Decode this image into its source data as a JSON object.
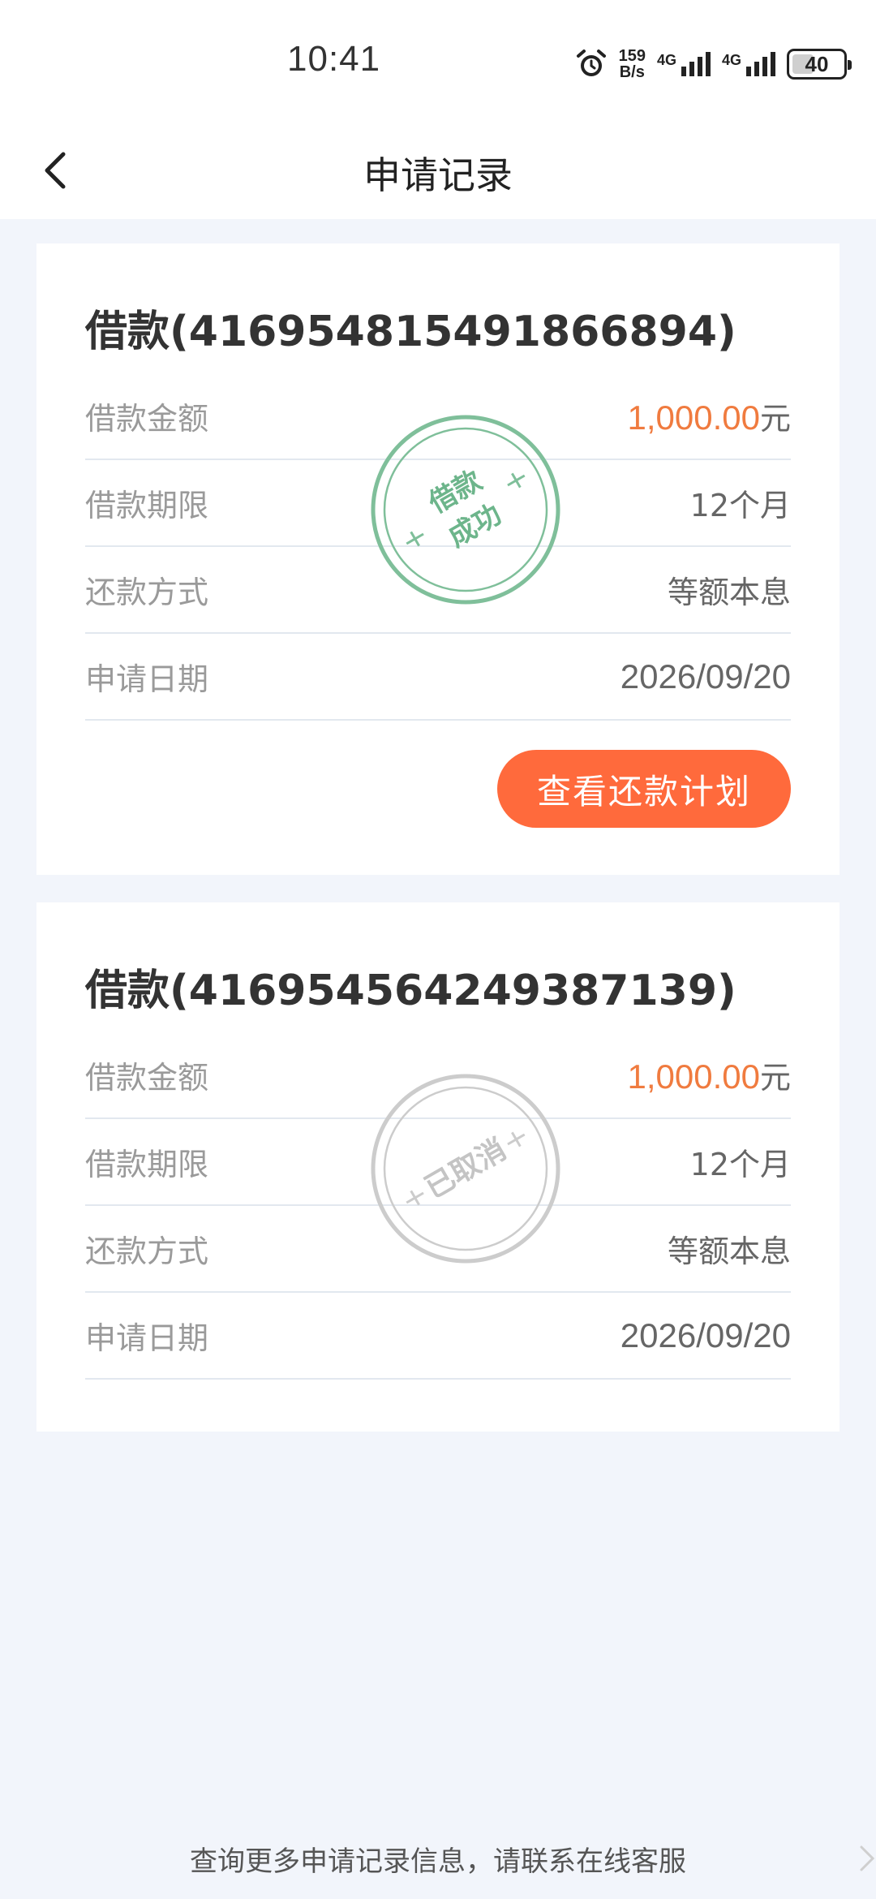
{
  "status_bar": {
    "time": "10:41",
    "net_speed_value": "159",
    "net_speed_unit": "B/s",
    "signal_1_label": "4G",
    "signal_2_label": "4G",
    "battery_level": "40"
  },
  "nav": {
    "title": "申请记录"
  },
  "records": [
    {
      "title": "借款(416954815491866894)",
      "amount_label": "借款金额",
      "amount_value": "1,000.00",
      "amount_unit": "元",
      "term_label": "借款期限",
      "term_value": "12个月",
      "method_label": "还款方式",
      "method_value": "等额本息",
      "date_label": "申请日期",
      "date_value": "2026/09/20",
      "stamp_line1": "借款",
      "stamp_line2": "成功",
      "stamp_color": "#7fbf9a",
      "action_label": "查看还款计划"
    },
    {
      "title": "借款(416954564249387139)",
      "amount_label": "借款金额",
      "amount_value": "1,000.00",
      "amount_unit": "元",
      "term_label": "借款期限",
      "term_value": "12个月",
      "method_label": "还款方式",
      "method_value": "等额本息",
      "date_label": "申请日期",
      "date_value": "2026/09/20",
      "stamp_text": "已取消",
      "stamp_color": "#cccccc"
    }
  ],
  "footer": {
    "text": "查询更多申请记录信息，请联系在线客服"
  },
  "colors": {
    "accent": "#ff6a3c",
    "amount": "#f07b3f",
    "background": "#f2f5fb"
  }
}
